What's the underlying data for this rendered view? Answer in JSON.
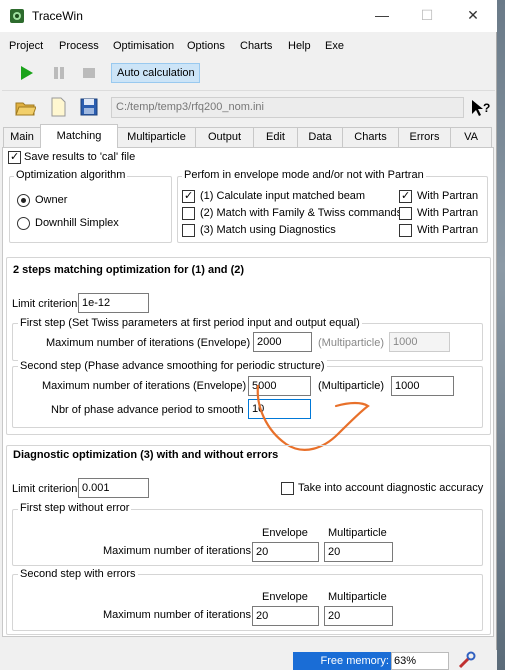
{
  "window": {
    "title": "TraceWin",
    "minimize": "—",
    "maximize": "☐",
    "close": "✕"
  },
  "menu": [
    "Project",
    "Process",
    "Optimisation",
    "Options",
    "Charts",
    "Help",
    "Exe"
  ],
  "toolbar": {
    "auto_calculation": "Auto calculation",
    "project_path": "C:/temp/temp3/rfq200_nom.ini"
  },
  "tabs": [
    "Main",
    "Matching",
    "Multiparticle",
    "Output",
    "Edit",
    "Data",
    "Charts",
    "Errors",
    "VA"
  ],
  "active_tab": "Matching",
  "save_results": {
    "label": "Save results to 'cal' file",
    "checked": true
  },
  "opt_algorithm": {
    "title": "Optimization algorithm",
    "options": [
      "Owner",
      "Downhill Simplex"
    ],
    "selected": "Owner"
  },
  "envelope_mode": {
    "title": "Perfom in envelope mode and/or not with Partran",
    "rows": [
      {
        "label": "(1) Calculate input matched beam",
        "checked": true,
        "partran_label": "With Partran",
        "partran_checked": true
      },
      {
        "label": "(2) Match with Family & Twiss commands",
        "checked": false,
        "partran_label": "With Partran",
        "partran_checked": false
      },
      {
        "label": "(3) Match using Diagnostics",
        "checked": false,
        "partran_label": "With Partran",
        "partran_checked": false
      }
    ]
  },
  "two_steps": {
    "title": "2 steps matching optimization for (1) and (2)",
    "limit_label": "Limit criterion",
    "limit_value": "1e-12",
    "first_step": {
      "title": "First step (Set Twiss parameters at first period input and output equal)",
      "max_iter_label": "Maximum number of iterations (Envelope)",
      "max_iter_value": "2000",
      "multi_label": "(Multiparticle)",
      "multi_value": "1000"
    },
    "second_step": {
      "title": "Second step (Phase advance smoothing for periodic structure)",
      "max_iter_label": "Maximum number of iterations (Envelope)",
      "max_iter_value": "5000",
      "multi_label": "(Multiparticle)",
      "multi_value": "1000",
      "nbr_label": "Nbr of phase advance period to smooth",
      "nbr_value": "10"
    }
  },
  "diagnostic": {
    "title": "Diagnostic optimization (3) with and without errors",
    "limit_label": "Limit criterion",
    "limit_value": "0.001",
    "accuracy_label": "Take into account diagnostic accuracy",
    "accuracy_checked": false,
    "first_step": {
      "title": "First step without error",
      "col_env": "Envelope",
      "col_multi": "Multiparticle",
      "row_label": "Maximum number of iterations",
      "env_value": "20",
      "multi_value": "20"
    },
    "second_step": {
      "title": "Second step with errors",
      "col_env": "Envelope",
      "col_multi": "Multiparticle",
      "row_label": "Maximum number of iterations",
      "env_value": "20",
      "multi_value": "20"
    }
  },
  "status": {
    "free_memory_label": "Free memory:",
    "free_memory_value": "63%"
  },
  "colors": {
    "accent": "#0078d7",
    "annotation": "#e8702a",
    "memory_bar": "#1a6dd6"
  }
}
